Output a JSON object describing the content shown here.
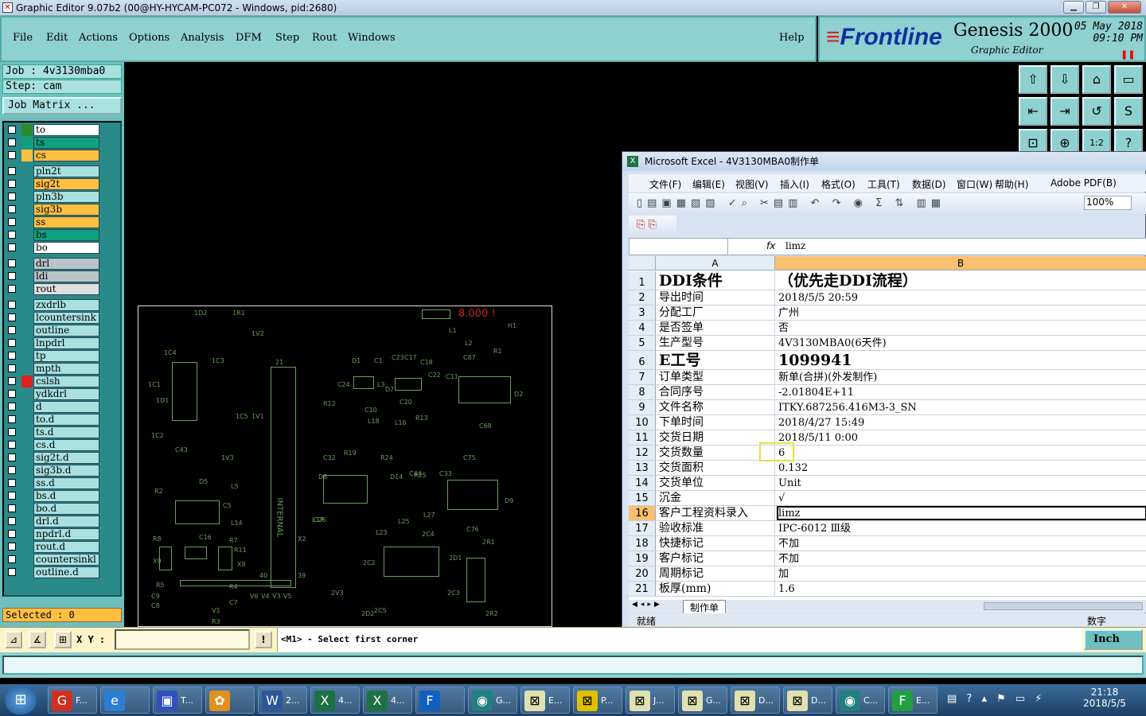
{
  "window": {
    "title": "Graphic Editor 9.07b2 (00@HY-HYCAM-PC072 - Windows, pid:2680)"
  },
  "menu": [
    "File",
    "Edit",
    "Actions",
    "Options",
    "Analysis",
    "DFM",
    "Step",
    "Rout",
    "Windows"
  ],
  "help": "Help",
  "logo": {
    "brand": "Frontline",
    "product": "Genesis 2000",
    "sub": "Graphic Editor",
    "date": "05 May 2018",
    "time": "09:10 PM"
  },
  "job": {
    "job": "Job  : 4v3130mba0",
    "step": "Step: cam",
    "matrix": "Job Matrix ..."
  },
  "layers": [
    {
      "name": "to",
      "color": "#ffffff",
      "sw": "#2a8a2a"
    },
    {
      "name": "ts",
      "color": "#10a080",
      "sw": "#10a080"
    },
    {
      "name": "cs",
      "color": "#ffc040",
      "sw": "#ffc040"
    },
    {
      "name": "pln2t",
      "color": "#a9e0e0",
      "sw": ""
    },
    {
      "name": "sig2t",
      "color": "#ffc040",
      "sw": ""
    },
    {
      "name": "pln3b",
      "color": "#a9e0e0",
      "sw": ""
    },
    {
      "name": "sig3b",
      "color": "#ffc040",
      "sw": ""
    },
    {
      "name": "ss",
      "color": "#ffc040",
      "sw": ""
    },
    {
      "name": "bs",
      "color": "#10a080",
      "sw": ""
    },
    {
      "name": "bo",
      "color": "#ffffff",
      "sw": ""
    },
    {
      "name": "drl",
      "color": "#b8c4c8",
      "sw": ""
    },
    {
      "name": "ldi",
      "color": "#b8c4c8",
      "sw": ""
    },
    {
      "name": "rout",
      "color": "#e0e0e0",
      "sw": ""
    },
    {
      "name": "zxdrlb",
      "color": "#a9e0e0",
      "sw": ""
    },
    {
      "name": "lcountersink",
      "color": "#a9e0e0",
      "sw": ""
    },
    {
      "name": "outline",
      "color": "#a9e0e0",
      "sw": ""
    },
    {
      "name": "lnpdrl",
      "color": "#a9e0e0",
      "sw": ""
    },
    {
      "name": "tp",
      "color": "#a9e0e0",
      "sw": ""
    },
    {
      "name": "mpth",
      "color": "#a9e0e0",
      "sw": ""
    },
    {
      "name": "cslsh",
      "color": "#a9e0e0",
      "sw": "#e02020"
    },
    {
      "name": "ydkdrl",
      "color": "#a9e0e0",
      "sw": ""
    },
    {
      "name": "d",
      "color": "#a9e0e0",
      "sw": ""
    },
    {
      "name": "to.d",
      "color": "#a9e0e0",
      "sw": ""
    },
    {
      "name": "ts.d",
      "color": "#a9e0e0",
      "sw": ""
    },
    {
      "name": "cs.d",
      "color": "#a9e0e0",
      "sw": ""
    },
    {
      "name": "sig2t.d",
      "color": "#a9e0e0",
      "sw": ""
    },
    {
      "name": "sig3b.d",
      "color": "#a9e0e0",
      "sw": ""
    },
    {
      "name": "ss.d",
      "color": "#a9e0e0",
      "sw": ""
    },
    {
      "name": "bs.d",
      "color": "#a9e0e0",
      "sw": ""
    },
    {
      "name": "bo.d",
      "color": "#a9e0e0",
      "sw": ""
    },
    {
      "name": "drl.d",
      "color": "#a9e0e0",
      "sw": ""
    },
    {
      "name": "npdrl.d",
      "color": "#a9e0e0",
      "sw": ""
    },
    {
      "name": "rout.d",
      "color": "#a9e0e0",
      "sw": ""
    },
    {
      "name": "countersinkl",
      "color": "#a9e0e0",
      "sw": ""
    },
    {
      "name": "outline.d",
      "color": "#a9e0e0",
      "sw": ""
    }
  ],
  "selected": "Selected : 0",
  "tools": [
    "upload-icon",
    "download-icon",
    "home-icon",
    "window-icon",
    "import-icon",
    "export-icon",
    "undo-icon",
    "s-icon",
    "fit-icon",
    "center-icon",
    "scale-icon",
    "help-icon"
  ],
  "tool_glyphs": [
    "⇧",
    "⇩",
    "⌂",
    "▭",
    "⇤",
    "⇥",
    "↺",
    "S",
    "⊡",
    "⊕",
    "1:2",
    "?"
  ],
  "pcb_labels": [
    "1D2",
    "1R1",
    "1V2",
    "1C4",
    "1C3",
    "1C1",
    "1D1",
    "1C5",
    "1V1",
    "1C2",
    "C43",
    "1V3",
    "D5",
    "L5",
    "R2",
    "C5",
    "L14",
    "R8",
    "C16",
    "R7",
    "R11",
    "X9",
    "X8",
    "R5",
    "R4",
    "C9",
    "C8",
    "V1",
    "R3",
    "C7",
    "X2",
    "INTERNAL",
    "40",
    "39",
    "V6",
    "V4",
    "V3",
    "V5",
    "21",
    "D1",
    "C1",
    "C23",
    "C17",
    "C18",
    "C24",
    "L3",
    "D7",
    "C22",
    "C11",
    "C20",
    "R12",
    "C10",
    "L18",
    "L16",
    "R13",
    "L1",
    "L2",
    "C87",
    "R1",
    "H1",
    "D2",
    "C68",
    "C32",
    "R19",
    "R24",
    "D14",
    "R25",
    "C44",
    "C33",
    "C75",
    "D9",
    "D8",
    "L17",
    "C26",
    "L25",
    "L27",
    "C76",
    "L23",
    "2C4",
    "2R1",
    "2D1",
    "2C2",
    "2C3",
    "2D2",
    "2V3",
    "2C5",
    "2R2",
    "8.000 !"
  ],
  "excel": {
    "title": "Microsoft Excel - 4V3130MBA0制作单",
    "menu": [
      "文件(F)",
      "编辑(E)",
      "视图(V)",
      "插入(I)",
      "格式(O)",
      "工具(T)",
      "数据(D)",
      "窗口(W)",
      "帮助(H)",
      "Adobe PDF(B)"
    ],
    "zoom": "100%",
    "formula": "limz",
    "cols": [
      "A",
      "B"
    ],
    "rows": [
      {
        "n": "1",
        "a": "DDI条件",
        "b": "（优先走DDI流程）",
        "big": true
      },
      {
        "n": "2",
        "a": "导出时间",
        "b": "2018/5/5 20:59"
      },
      {
        "n": "3",
        "a": "分配工厂",
        "b": "广州"
      },
      {
        "n": "4",
        "a": "是否签单",
        "b": "否"
      },
      {
        "n": "5",
        "a": "生产型号",
        "b": "4V3130MBA0(6天件)"
      },
      {
        "n": "6",
        "a": "E工号",
        "b": "1099941",
        "big": true
      },
      {
        "n": "7",
        "a": "订单类型",
        "b": "新单(合拼)(外发制作)"
      },
      {
        "n": "8",
        "a": "合同序号",
        "b": "-2.01804E+11"
      },
      {
        "n": "9",
        "a": "文件名称",
        "b": "ITKY.687256.416M3-3_SN"
      },
      {
        "n": "10",
        "a": "下单时间",
        "b": "2018/4/27 15:49"
      },
      {
        "n": "11",
        "a": "交货日期",
        "b": "2018/5/11 0:00"
      },
      {
        "n": "12",
        "a": "交货数量",
        "b": "6"
      },
      {
        "n": "13",
        "a": "交货面积",
        "b": "0.132"
      },
      {
        "n": "14",
        "a": "交货单位",
        "b": "Unit"
      },
      {
        "n": "15",
        "a": "沉金",
        "b": "√"
      },
      {
        "n": "16",
        "a": "客户工程资料录入",
        "b": "limz"
      },
      {
        "n": "17",
        "a": "验收标准",
        "b": "IPC-6012 Ⅲ级"
      },
      {
        "n": "18",
        "a": "快捷标记",
        "b": "不加"
      },
      {
        "n": "19",
        "a": "客户标记",
        "b": "不加"
      },
      {
        "n": "20",
        "a": "周期标记",
        "b": "加"
      },
      {
        "n": "21",
        "a": "板厚(mm)",
        "b": "1.6"
      }
    ],
    "sheet_tab": "制作单",
    "status": "就绪",
    "status_right": "数字"
  },
  "cmd": {
    "xy_label": "X Y :",
    "prompt": "<M1> - Select first corner",
    "units": "Inch"
  },
  "taskbar": {
    "items": [
      {
        "icon": "G",
        "label": "F...",
        "color": "#d03020"
      },
      {
        "icon": "e",
        "label": "",
        "color": "#2a7fd4"
      },
      {
        "icon": "▣",
        "label": "T...",
        "color": "#3050c0"
      },
      {
        "icon": "✿",
        "label": "",
        "color": "#e09020"
      },
      {
        "icon": "W",
        "label": "2...",
        "color": "#2b579a"
      },
      {
        "icon": "X",
        "label": "4...",
        "color": "#1e7145"
      },
      {
        "icon": "X",
        "label": "4...",
        "color": "#1e7145"
      },
      {
        "icon": "F",
        "label": "",
        "color": "#1060c0"
      },
      {
        "icon": "◉",
        "label": "G...",
        "color": "#208080"
      },
      {
        "icon": "⊠",
        "label": "E...",
        "color": "#e0e0b0"
      },
      {
        "icon": "⊠",
        "label": "P...",
        "color": "#e0c000"
      },
      {
        "icon": "⊠",
        "label": "J...",
        "color": "#e0e0b0"
      },
      {
        "icon": "⊠",
        "label": "G...",
        "color": "#e0e0b0"
      },
      {
        "icon": "⊠",
        "label": "D...",
        "color": "#e0e0b0"
      },
      {
        "icon": "⊠",
        "label": "D...",
        "color": "#e0e0b0"
      },
      {
        "icon": "◉",
        "label": "C...",
        "color": "#208080"
      },
      {
        "icon": "F",
        "label": "E...",
        "color": "#20a040"
      }
    ],
    "time": "21:18",
    "date": "2018/5/5"
  }
}
